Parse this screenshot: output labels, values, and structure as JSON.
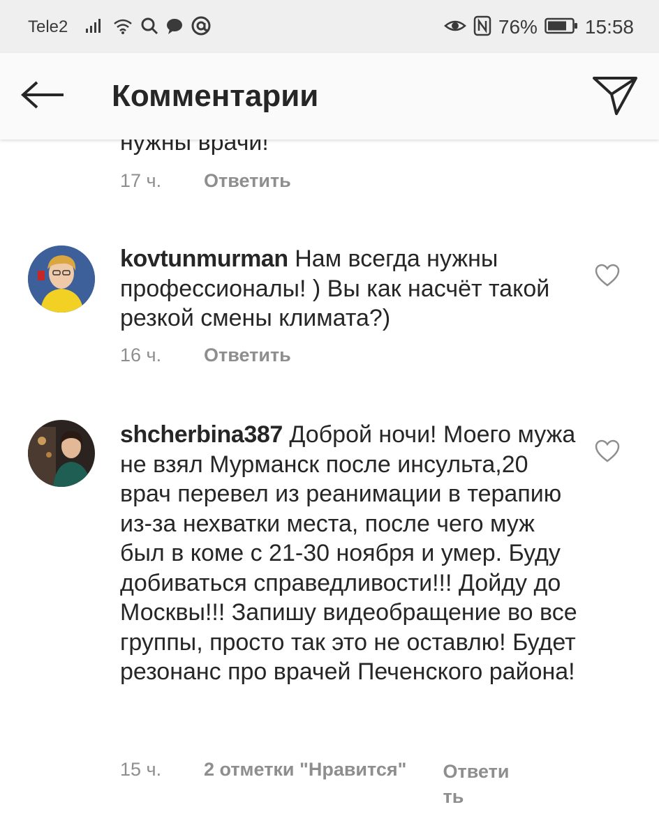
{
  "status_bar": {
    "carrier": "Tele2",
    "battery": "76%",
    "time": "15:58",
    "icons": [
      "signal-icon",
      "wifi-icon",
      "search-icon",
      "chat-bubble-icon",
      "at-sign-icon",
      "eye-icon",
      "nfc-icon",
      "battery-icon"
    ]
  },
  "header": {
    "title": "Комментарии",
    "back_icon": "arrow-left-icon",
    "share_icon": "paper-plane-icon"
  },
  "comments": [
    {
      "partial_text": "нужны врачи!",
      "time": "17 ч.",
      "reply_label": "Ответить"
    },
    {
      "username": "kovtunmurman",
      "text": " Нам всегда нужны профессионалы! ) Вы как насчёт такой резкой смены климата?)",
      "time": "16 ч.",
      "reply_label": "Ответить"
    },
    {
      "username": "shcherbina387",
      "text": " Доброй ночи! Моего мужа не взял Мурманск после инсульта,20 врач перевел из реанимации в терапию из-за нехватки места, после чего муж был в коме с 21-30 ноября и умер. Буду добиваться справедливости!!! Дойду до Москвы!!! Запишу видеобращение во все группы, просто так это не оставлю! Будет резонанс про врачей Печенского района!",
      "time": "15 ч.",
      "likes": "2 отметки \"Нравится\"",
      "reply_label": "Ответи ть"
    }
  ],
  "colors": {
    "status_bar_bg": "#efefef",
    "header_bg": "#fafafa",
    "text": "#262626",
    "secondary_text": "#8e8e8e"
  }
}
